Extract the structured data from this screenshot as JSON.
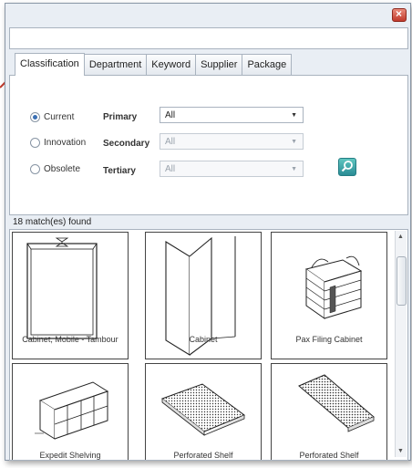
{
  "tabs": [
    "Classification",
    "Department",
    "Keyword",
    "Supplier",
    "Package"
  ],
  "active_tab": "Classification",
  "status_options": [
    {
      "label": "Current",
      "selected": true
    },
    {
      "label": "Innovation",
      "selected": false
    },
    {
      "label": "Obsolete",
      "selected": false
    }
  ],
  "filters": [
    {
      "label": "Primary",
      "value": "All",
      "enabled": true
    },
    {
      "label": "Secondary",
      "value": "All",
      "enabled": false
    },
    {
      "label": "Tertiary",
      "value": "All",
      "enabled": false
    }
  ],
  "results": {
    "count_text": "18 match(es) found",
    "items": [
      {
        "label": "Cabinet, Mobile - Tambour"
      },
      {
        "label": "Cabinet"
      },
      {
        "label": "Pax Filing Cabinet"
      },
      {
        "label": "Expedit Shelving"
      },
      {
        "label": "Perforated Shelf"
      },
      {
        "label": "Perforated Shelf"
      }
    ]
  },
  "colors": {
    "window_bg": "#e9eef4",
    "close_button": "#c0392b",
    "search_button": "#2a8c95",
    "radio_selected": "#3b6fb4"
  },
  "icons": {
    "close": "close-icon",
    "search": "search-icon",
    "dropdown": "chevron-down-icon"
  }
}
